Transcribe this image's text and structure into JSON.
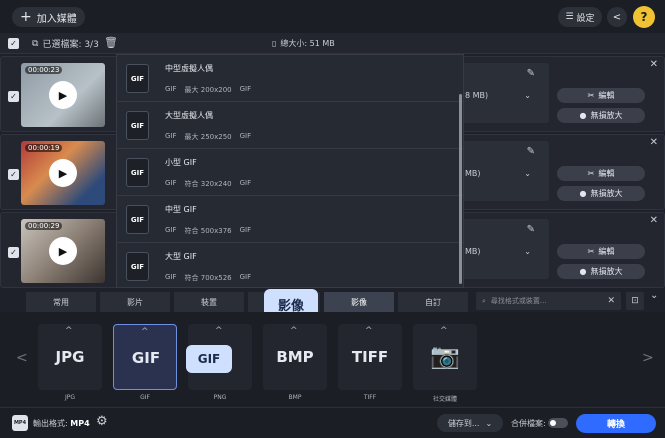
{
  "topbar": {
    "add_media": "加入媒體",
    "settings": "設定",
    "help": "?"
  },
  "toolbar": {
    "selected_label": "已選檔案: 3/3",
    "total_size": "總大小: 51 MB"
  },
  "files": [
    {
      "duration": "00:00:23",
      "size": "8 MB)",
      "edit": "編輯",
      "ai": "無損放大"
    },
    {
      "duration": "00:00:19",
      "size": "MB)",
      "edit": "編輯",
      "ai": "無損放大"
    },
    {
      "duration": "00:00:29",
      "size": "MB)",
      "edit": "編輯",
      "ai": "無損放大"
    }
  ],
  "presets": [
    {
      "name": "中型虛擬人偶",
      "fmt": "GIF",
      "size": "最大 200x200",
      "codec": "GIF"
    },
    {
      "name": "大型虛擬人偶",
      "fmt": "GIF",
      "size": "最大 250x250",
      "codec": "GIF"
    },
    {
      "name": "小型 GIF",
      "fmt": "GIF",
      "size": "符合 320x240",
      "codec": "GIF"
    },
    {
      "name": "中型 GIF",
      "fmt": "GIF",
      "size": "符合 500x376",
      "codec": "GIF"
    },
    {
      "name": "大型 GIF",
      "fmt": "GIF",
      "size": "符合 700x526",
      "codec": "GIF"
    }
  ],
  "tabs": [
    "常用",
    "影片",
    "裝置",
    "",
    "影像",
    "自訂"
  ],
  "active_tab_index": 4,
  "callout_tab": "影像",
  "search_placeholder": "尋找格式或裝置...",
  "formats": [
    {
      "big": "JPG",
      "label": "JPG"
    },
    {
      "big": "GIF",
      "label": "GIF"
    },
    {
      "big": "G",
      "label": "PNG"
    },
    {
      "big": "BMP",
      "label": "BMP"
    },
    {
      "big": "TIFF",
      "label": "TIFF"
    },
    {
      "big": "",
      "label": "社交媒體"
    }
  ],
  "callout_format": "GIF",
  "bottom": {
    "output_prefix": "輸出格式:",
    "output_value": "MP4",
    "save_to": "儲存到...",
    "merge": "合併檔案:",
    "convert": "轉換"
  },
  "colors": {
    "accent": "#2f6bff",
    "help": "#f1c232",
    "callout": "#cfe0ff"
  }
}
